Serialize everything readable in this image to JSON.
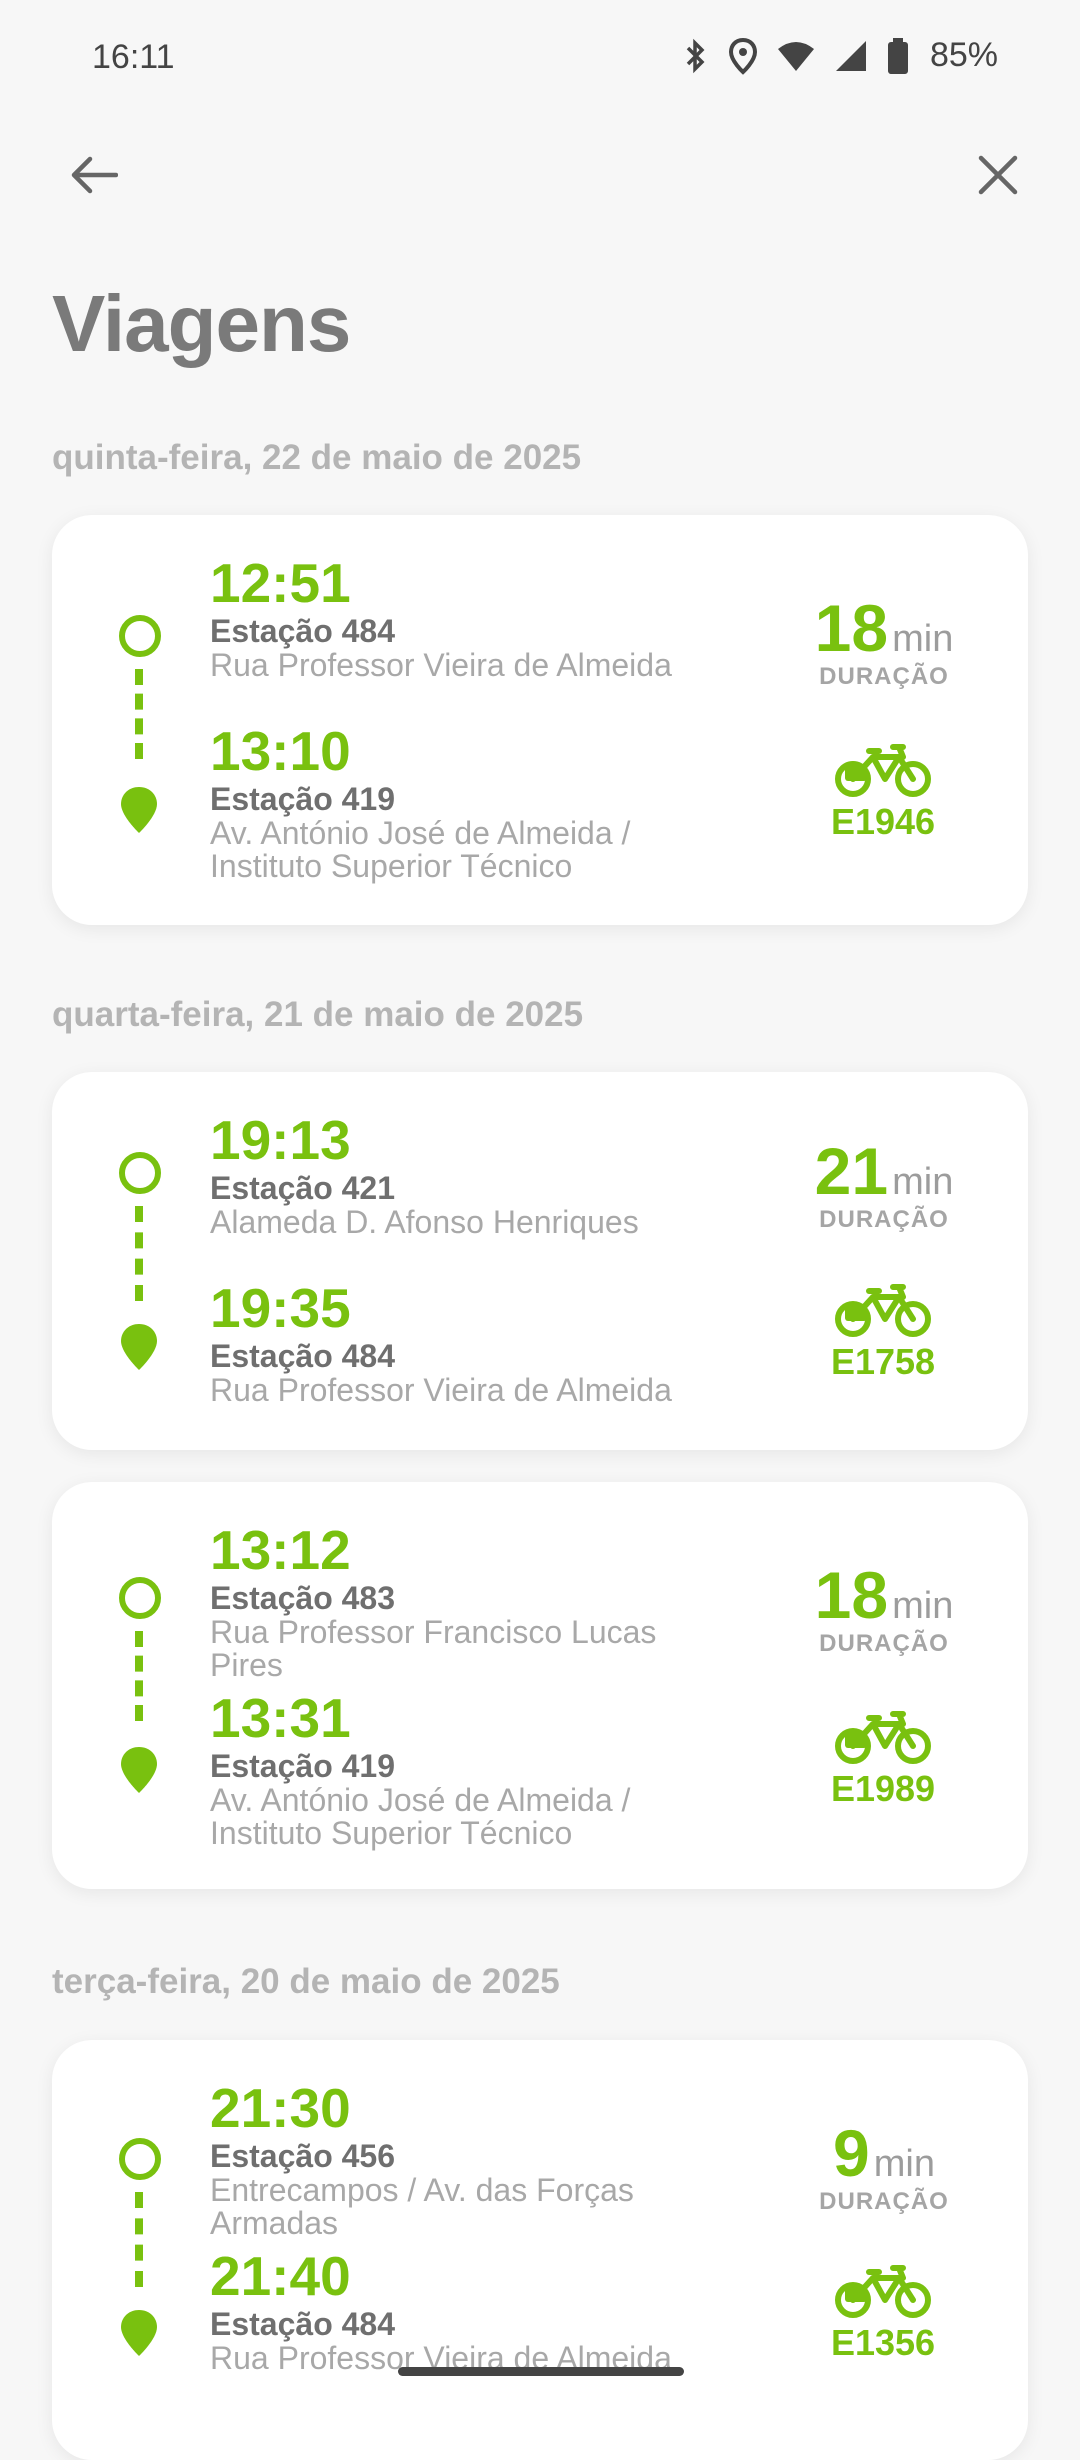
{
  "status_bar": {
    "time": "16:11",
    "battery": "85%",
    "icons": [
      "bluetooth-icon",
      "location-icon",
      "wifi-icon",
      "signal-icon",
      "battery-icon"
    ]
  },
  "nav": {
    "back_icon": "arrow-left-icon",
    "close_icon": "close-icon"
  },
  "page_title": "Viagens",
  "colors": {
    "accent": "#79c10f",
    "title": "#7a7a7a",
    "date": "#b4b4b4",
    "background": "#f7f7f7"
  },
  "groups": [
    {
      "date": "quinta-feira, 22 de maio de 2025",
      "trips": [
        {
          "start": {
            "time": "12:51",
            "station": "Estação 484",
            "address": "Rua Professor Vieira de Almeida"
          },
          "end": {
            "time": "13:10",
            "station": "Estação 419",
            "address": "Av. António José de Almeida / Instituto Superior Técnico"
          },
          "duration": "18",
          "duration_unit": "min",
          "duration_label": "DURAÇÃO",
          "bike_id": "E1946"
        }
      ]
    },
    {
      "date": "quarta-feira, 21 de maio de 2025",
      "trips": [
        {
          "start": {
            "time": "19:13",
            "station": "Estação 421",
            "address": "Alameda D. Afonso Henriques"
          },
          "end": {
            "time": "19:35",
            "station": "Estação 484",
            "address": "Rua Professor Vieira de Almeida"
          },
          "duration": "21",
          "duration_unit": "min",
          "duration_label": "DURAÇÃO",
          "bike_id": "E1758"
        },
        {
          "start": {
            "time": "13:12",
            "station": "Estação 483",
            "address": "Rua Professor Francisco Lucas Pires"
          },
          "end": {
            "time": "13:31",
            "station": "Estação 419",
            "address": "Av. António José de Almeida / Instituto Superior Técnico"
          },
          "duration": "18",
          "duration_unit": "min",
          "duration_label": "DURAÇÃO",
          "bike_id": "E1989"
        }
      ]
    },
    {
      "date": "terça-feira, 20 de maio de 2025",
      "trips": [
        {
          "start": {
            "time": "21:30",
            "station": "Estação 456",
            "address": "Entrecampos / Av. das Forças Armadas"
          },
          "end": {
            "time": "21:40",
            "station": "Estação 484",
            "address": "Rua Professor Vieira de Almeida"
          },
          "duration": "9",
          "duration_unit": "min",
          "duration_label": "DURAÇÃO",
          "bike_id": "E1356"
        }
      ]
    }
  ]
}
